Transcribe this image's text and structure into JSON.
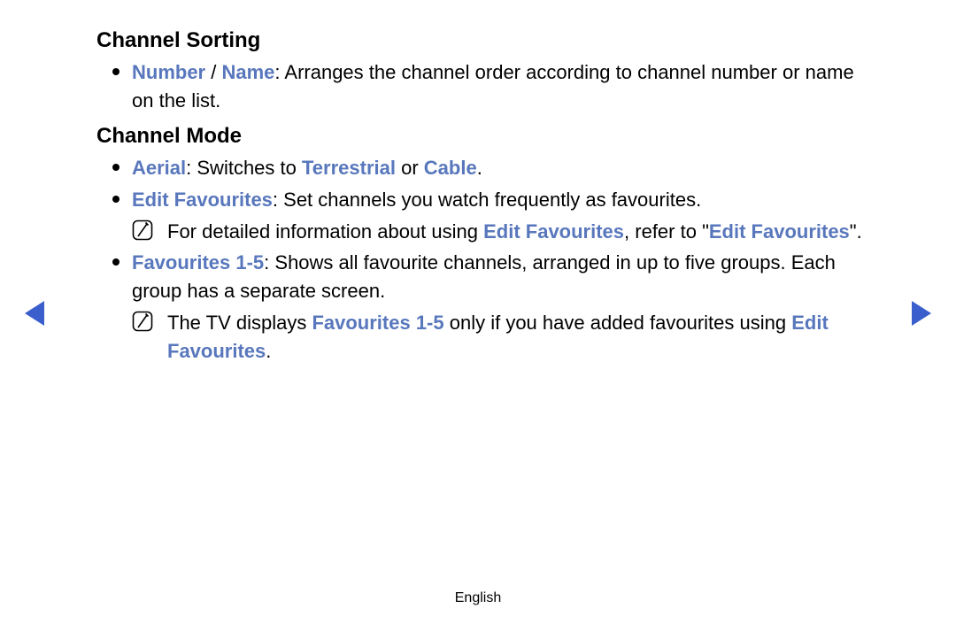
{
  "accent": "#5877bc",
  "sections": {
    "sorting": {
      "heading": "Channel Sorting",
      "item1": {
        "kw_number": "Number",
        "sep": " / ",
        "kw_name": "Name",
        "rest": ": Arranges the channel order according to channel number or name on the list."
      }
    },
    "mode": {
      "heading": "Channel Mode",
      "aerial": {
        "kw_aerial": "Aerial",
        "t1": ": Switches to ",
        "kw_terr": "Terrestrial",
        "t2": " or ",
        "kw_cable": "Cable",
        "t3": "."
      },
      "editfav": {
        "kw": "Edit Favourites",
        "rest": ": Set channels you watch frequently as favourites."
      },
      "note1": {
        "t1": "For detailed information about using ",
        "kw1": "Edit Favourites",
        "t2": ", refer to \"",
        "kw2": "Edit Favourites",
        "t3": "\"."
      },
      "fav15": {
        "kw": "Favourites 1-5",
        "rest": ": Shows all favourite channels, arranged in up to five groups. Each group has a separate screen."
      },
      "note2": {
        "t1": "The TV displays ",
        "kw1": "Favourites 1-5",
        "t2": " only if you have added favourites using ",
        "kw2": "Edit Favourites",
        "t3": "."
      }
    }
  },
  "footer": "English"
}
